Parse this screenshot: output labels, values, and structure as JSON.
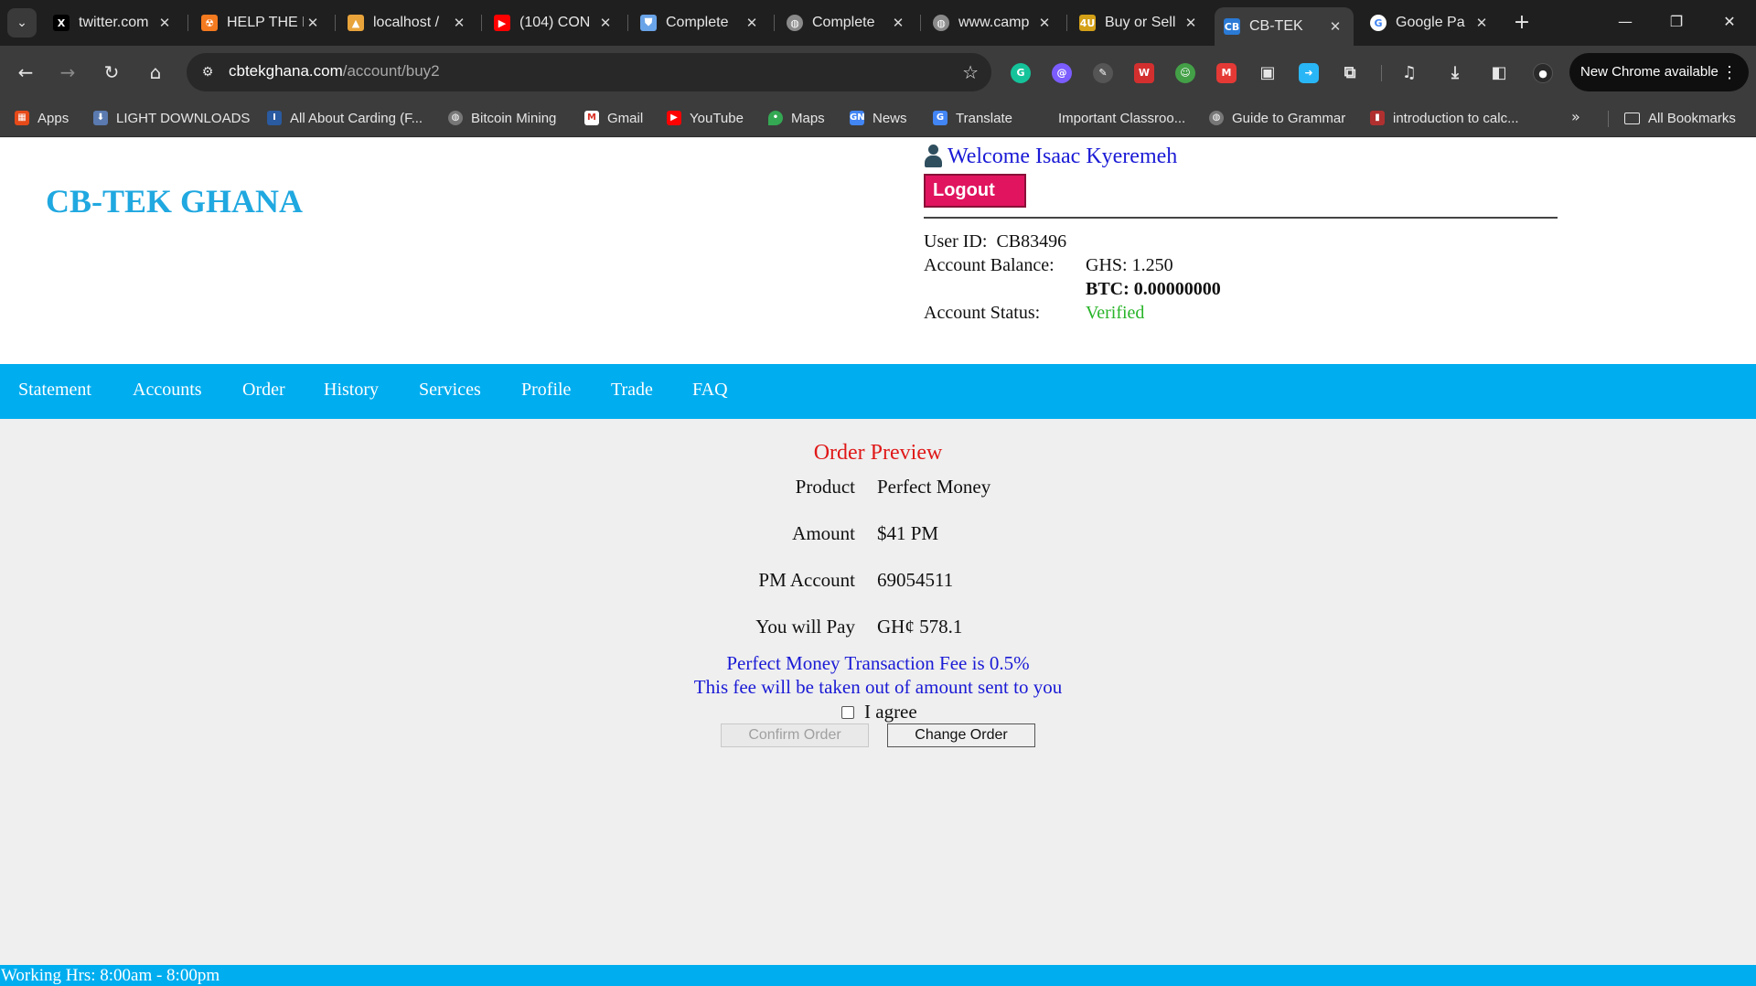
{
  "browser": {
    "tabs": [
      {
        "title": "twitter.com",
        "icon": "x-logo-icon",
        "color": "#000000"
      },
      {
        "title": "HELP THE N",
        "icon": "bug-icon",
        "color": "#f47a1f"
      },
      {
        "title": "localhost /",
        "icon": "phpmyadmin-icon",
        "color": "#e8a33a"
      },
      {
        "title": "(104) CON",
        "icon": "youtube-icon",
        "color": "#ff0000"
      },
      {
        "title": "Complete",
        "icon": "shield-icon",
        "color": "#6aa4e8"
      },
      {
        "title": "Complete",
        "icon": "globe-icon",
        "color": "#8a8a8a"
      },
      {
        "title": "www.camp",
        "icon": "globe-icon",
        "color": "#8a8a8a"
      },
      {
        "title": "Buy or Sell",
        "icon": "4u-icon",
        "color": "#d4a017"
      },
      {
        "title": "CB-TEK",
        "icon": "cb-tek-icon",
        "color": "#2a7ad6",
        "active": true
      },
      {
        "title": "Google Pa",
        "icon": "google-icon",
        "color": "#4285f4"
      }
    ],
    "url_host": "cbtekghana.com",
    "url_path": "/account/buy2",
    "update_label": "New Chrome available",
    "bookmarks": [
      {
        "label": "Apps",
        "icon": "apps-grid-icon",
        "color": "#e64a19"
      },
      {
        "label": "LIGHT DOWNLOADS",
        "icon": "download-icon",
        "color": "#5a7ab0"
      },
      {
        "label": "All About Carding (F...",
        "icon": "info-icon",
        "color": "#2a5aa0"
      },
      {
        "label": "Bitcoin Mining",
        "icon": "globe-icon",
        "color": "#777777"
      },
      {
        "label": "Gmail",
        "icon": "gmail-icon",
        "color": "#d93025"
      },
      {
        "label": "YouTube",
        "icon": "youtube-icon",
        "color": "#ff0000"
      },
      {
        "label": "Maps",
        "icon": "maps-pin-icon",
        "color": "#34a853"
      },
      {
        "label": "News",
        "icon": "news-icon",
        "color": "#4285f4"
      },
      {
        "label": "Translate",
        "icon": "translate-icon",
        "color": "#4285f4"
      },
      {
        "label": "Important Classroo...",
        "icon": "classroom-icon",
        "color": "#3c3c3c"
      },
      {
        "label": "Guide to Grammar",
        "icon": "globe-icon",
        "color": "#777777"
      },
      {
        "label": "introduction to calc...",
        "icon": "pdf-icon",
        "color": "#b03030"
      }
    ],
    "all_bookmarks_label": "All Bookmarks"
  },
  "site": {
    "logo": "CB-TEK GHANA",
    "welcome": "Welcome Isaac Kyeremeh",
    "logout": "Logout",
    "user_id_label": "User ID:",
    "user_id": "CB83496",
    "balance_label": "Account Balance:",
    "balance_ghs": "GHS: 1.250",
    "balance_btc": "BTC: 0.00000000",
    "status_label": "Account Status:",
    "status": "Verified",
    "nav": [
      "Statement",
      "Accounts",
      "Order",
      "History",
      "Services",
      "Profile",
      "Trade",
      "FAQ"
    ],
    "order": {
      "title": "Order Preview",
      "rows": [
        {
          "label": "Product",
          "value": "Perfect Money"
        },
        {
          "label": "Amount",
          "value": "$41 PM"
        },
        {
          "label": "PM Account",
          "value": "69054511"
        },
        {
          "label": "You will Pay",
          "value": "GH¢ 578.1"
        }
      ],
      "fee_line1": "Perfect Money Transaction Fee is 0.5%",
      "fee_line2": "This fee will be taken out of amount sent to you",
      "agree_label": "I agree",
      "agree_checked": false,
      "confirm": "Confirm Order",
      "change": "Change Order"
    },
    "footer": "Working Hrs: 8:00am - 8:00pm"
  },
  "colors": {
    "brand": "#20a8e0",
    "nav_bg": "#00adef",
    "logout": "#e0145f",
    "title_red": "#e01818",
    "link_blue": "#1a1ad6",
    "verified": "#28b428"
  }
}
